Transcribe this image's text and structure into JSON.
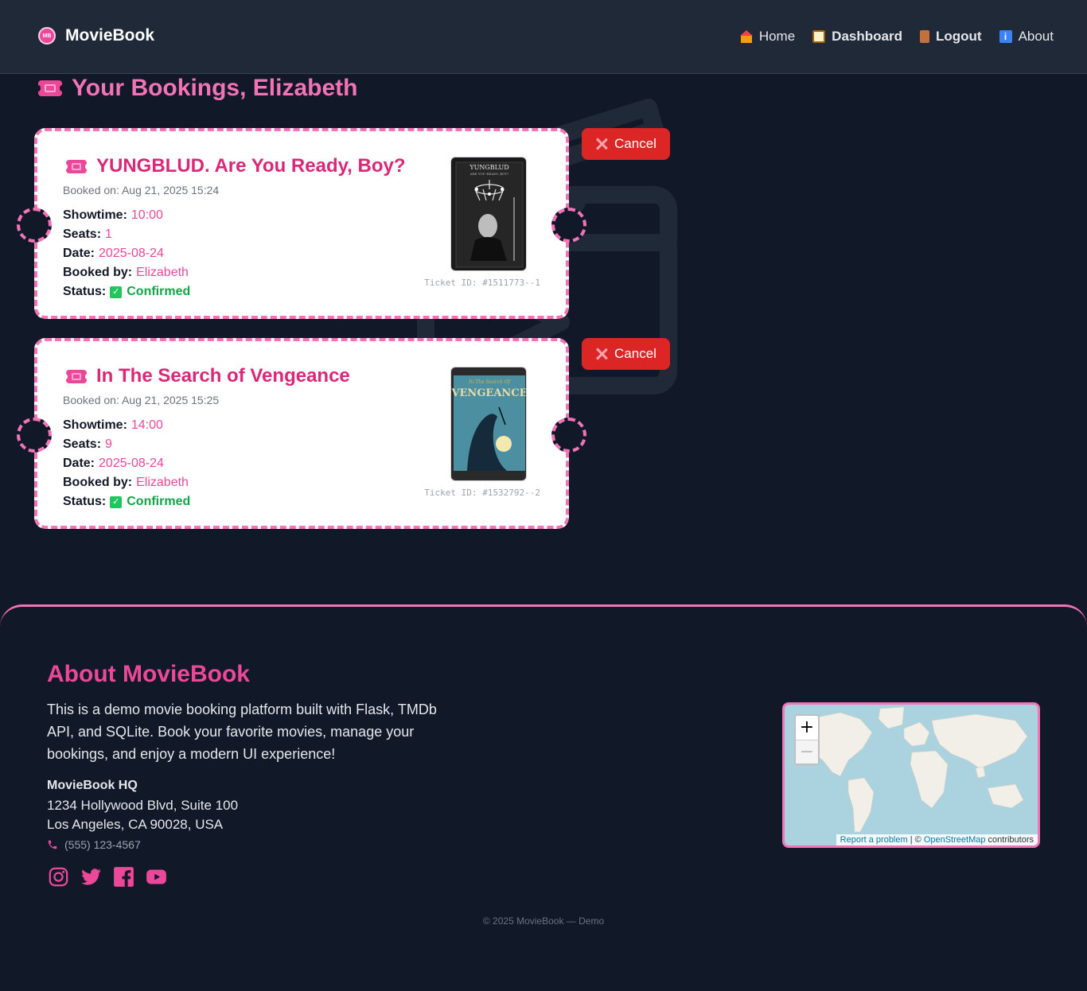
{
  "nav": {
    "brand_logo": "MB",
    "brand": "MovieBook",
    "links": [
      {
        "label": "Home",
        "icon": "house-icon"
      },
      {
        "label": "Dashboard",
        "icon": "clipboard-icon"
      },
      {
        "label": "Logout",
        "icon": "door-icon"
      },
      {
        "label": "About",
        "icon": "info-icon"
      }
    ]
  },
  "page": {
    "title": "Your Bookings, Elizabeth"
  },
  "bookings": [
    {
      "title": "YUNGBLUD. Are You Ready, Boy?",
      "booked_on": "Booked on: Aug 21, 2025 15:24",
      "showtime_label": "Showtime:",
      "showtime": "10:00",
      "seats_label": "Seats:",
      "seats": "1",
      "date_label": "Date:",
      "date": "2025-08-24",
      "booked_by_label": "Booked by:",
      "booked_by": "Elizabeth",
      "status_label": "Status:",
      "status": "Confirmed",
      "ticket_id": "Ticket ID: #1511773--1",
      "poster_text_1": "YUNGBLUD",
      "poster_text_2": "ARE YOU READY, BOY?",
      "cancel": "Cancel"
    },
    {
      "title": "In The Search of Vengeance",
      "booked_on": "Booked on: Aug 21, 2025 15:25",
      "showtime_label": "Showtime:",
      "showtime": "14:00",
      "seats_label": "Seats:",
      "seats": "9",
      "date_label": "Date:",
      "date": "2025-08-24",
      "booked_by_label": "Booked by:",
      "booked_by": "Elizabeth",
      "status_label": "Status:",
      "status": "Confirmed",
      "ticket_id": "Ticket ID: #1532792--2",
      "poster_text_1": "In The Search Of",
      "poster_text_2": "VENGEANCE",
      "cancel": "Cancel"
    }
  ],
  "footer": {
    "title": "About MovieBook",
    "description": "This is a demo movie booking platform built with Flask, TMDb API, and SQLite. Book your favorite movies, manage your bookings, and enjoy a modern UI experience!",
    "hq": "MovieBook HQ",
    "address1": "1234 Hollywood Blvd, Suite 100",
    "address2": "Los Angeles, CA 90028, USA",
    "phone": "(555) 123-4567",
    "social": [
      "instagram-icon",
      "twitter-icon",
      "facebook-icon",
      "youtube-icon"
    ],
    "copyright": "© 2025 MovieBook — Demo",
    "map": {
      "zoom_in": "+",
      "zoom_out": "−",
      "report": "Report a problem",
      "sep": " | © ",
      "osm": "OpenStreetMap",
      "contrib": " contributors"
    }
  },
  "colors": {
    "accent": "#ec4899",
    "cancel": "#dc2626",
    "confirmed": "#16a34a",
    "bg": "#111827",
    "nav_bg": "#1f2937"
  }
}
